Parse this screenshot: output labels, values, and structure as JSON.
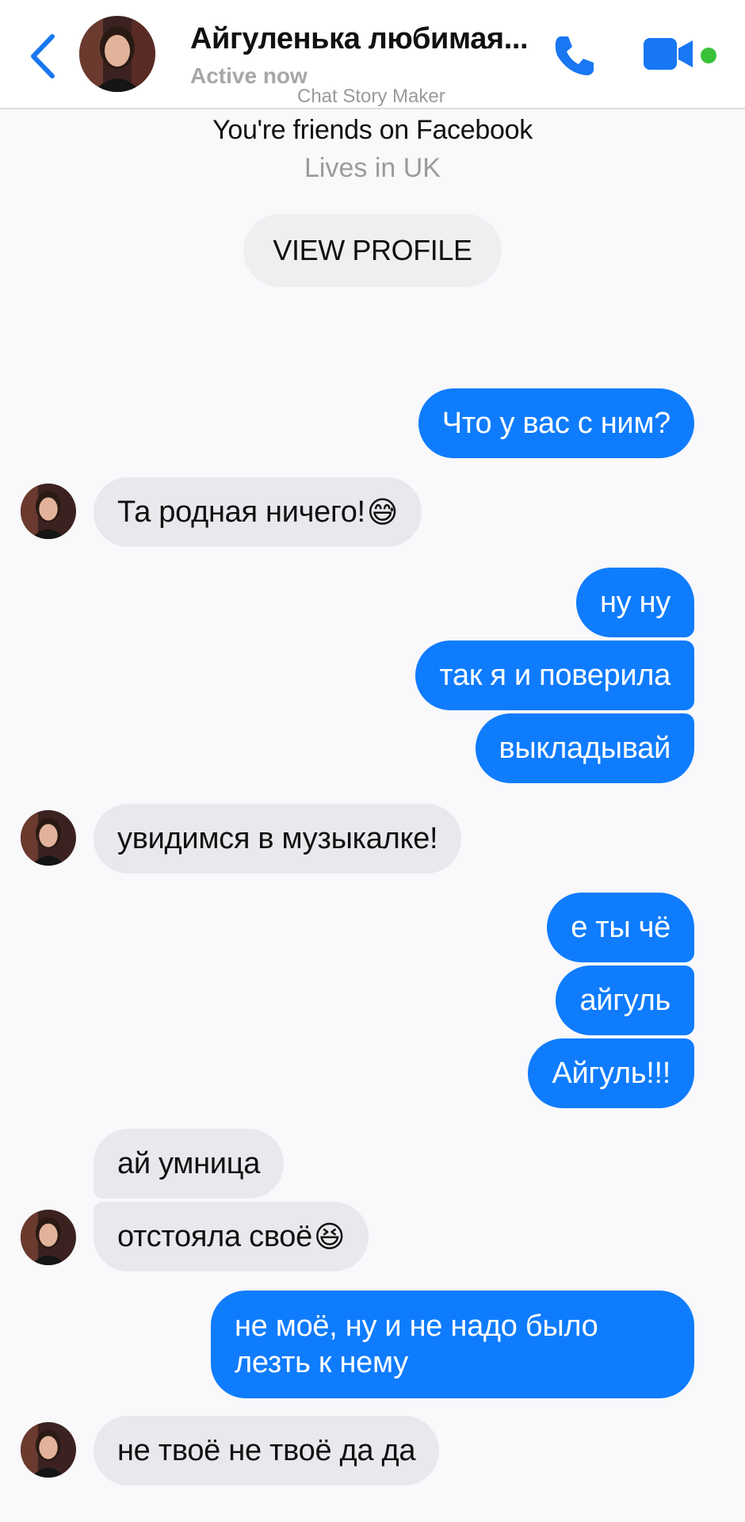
{
  "header": {
    "contact_name": "Айгуленька любимая...",
    "status": "Active now",
    "watermark": "Chat Story Maker"
  },
  "profile": {
    "friends_text": "You're friends on Facebook",
    "lives_text": "Lives in UK",
    "view_profile_label": "VIEW PROFILE"
  },
  "messages": [
    {
      "from": "me",
      "text": "Что у вас с ним?"
    },
    {
      "from": "contact",
      "text": "Та родная ничего!",
      "emoji": "😅"
    },
    {
      "from": "me",
      "text": "ну ну"
    },
    {
      "from": "me",
      "text": "так я и поверила"
    },
    {
      "from": "me",
      "text": "выкладывай"
    },
    {
      "from": "contact",
      "text": "увидимся в музыкалке!"
    },
    {
      "from": "me",
      "text": "е ты чё"
    },
    {
      "from": "me",
      "text": "айгуль"
    },
    {
      "from": "me",
      "text": "Айгуль!!!"
    },
    {
      "from": "contact",
      "text": "ай умница"
    },
    {
      "from": "contact",
      "text": "отстояла своё",
      "emoji": "😆"
    },
    {
      "from": "me",
      "text": "не моё, ну и не надо было лезть к нему"
    },
    {
      "from": "contact",
      "text": "не твоё не твоё да да"
    }
  ],
  "colors": {
    "sent_bubble": "#0f7cfe",
    "received_bubble": "#e9e8ec",
    "accent": "#1877f2",
    "online_dot": "#3ac13a"
  },
  "icons": [
    "back-arrow-icon",
    "phone-icon",
    "video-camera-icon",
    "online-status-dot"
  ]
}
